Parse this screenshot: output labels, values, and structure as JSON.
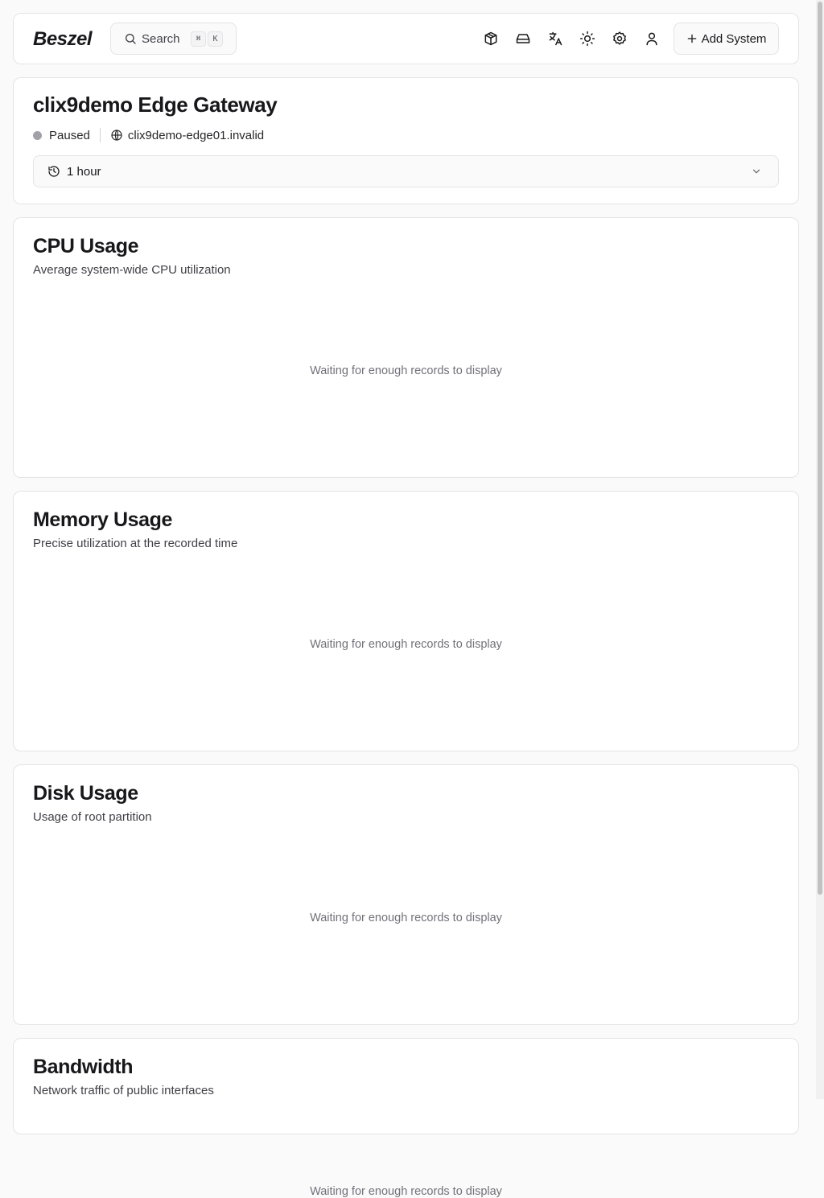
{
  "header": {
    "logo": "Beszel",
    "search_label": "Search",
    "search_kbd": [
      "⌘",
      "K"
    ],
    "icons": [
      "containers-icon",
      "drive-icon",
      "language-icon",
      "theme-sun-icon",
      "settings-icon",
      "user-icon"
    ],
    "add_system_label": "Add System"
  },
  "system": {
    "name": "clix9demo Edge Gateway",
    "status": "Paused",
    "status_color": "#a1a1aa",
    "host": "clix9demo-edge01.invalid",
    "time_range": "1 hour"
  },
  "charts": [
    {
      "title": "CPU Usage",
      "subtitle": "Average system-wide CPU utilization",
      "empty_text": "Waiting for enough records to display"
    },
    {
      "title": "Memory Usage",
      "subtitle": "Precise utilization at the recorded time",
      "empty_text": "Waiting for enough records to display"
    },
    {
      "title": "Disk Usage",
      "subtitle": "Usage of root partition",
      "empty_text": "Waiting for enough records to display"
    },
    {
      "title": "Bandwidth",
      "subtitle": "Network traffic of public interfaces",
      "empty_text": "Waiting for enough records to display"
    }
  ]
}
